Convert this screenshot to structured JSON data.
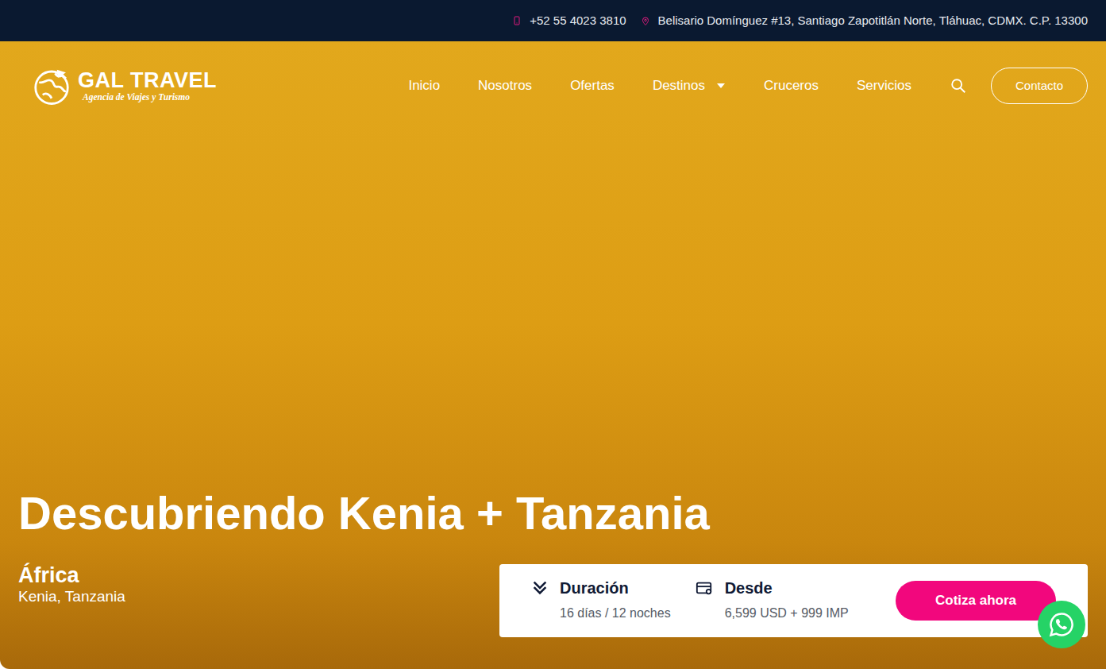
{
  "topbar": {
    "phone": "+52 55 4023 3810",
    "address": "Belisario Domínguez #13, Santiago Zapotitlán Norte, Tláhuac, CDMX. C.P. 13300"
  },
  "logo": {
    "name": "GAL TRAVEL",
    "tagline": "Agencia de Viajes y Turismo"
  },
  "nav": {
    "items": [
      {
        "label": "Inicio",
        "kind": "link"
      },
      {
        "label": "Nosotros",
        "kind": "link"
      },
      {
        "label": "Ofertas",
        "kind": "link"
      },
      {
        "label": "Destinos",
        "kind": "dropdown"
      },
      {
        "label": "Cruceros",
        "kind": "link"
      },
      {
        "label": "Servicios",
        "kind": "link"
      }
    ],
    "contact_button": "Contacto"
  },
  "tour": {
    "title": "Descubriendo Kenia + Tanzania",
    "region": "África",
    "countries": "Kenia, Tanzania",
    "duration_label": "Duración",
    "duration": "16 días / 12 noches",
    "price_label": "Desde",
    "price": "6,599 USD + 999 IMP",
    "cta": "Cotiza ahora"
  }
}
